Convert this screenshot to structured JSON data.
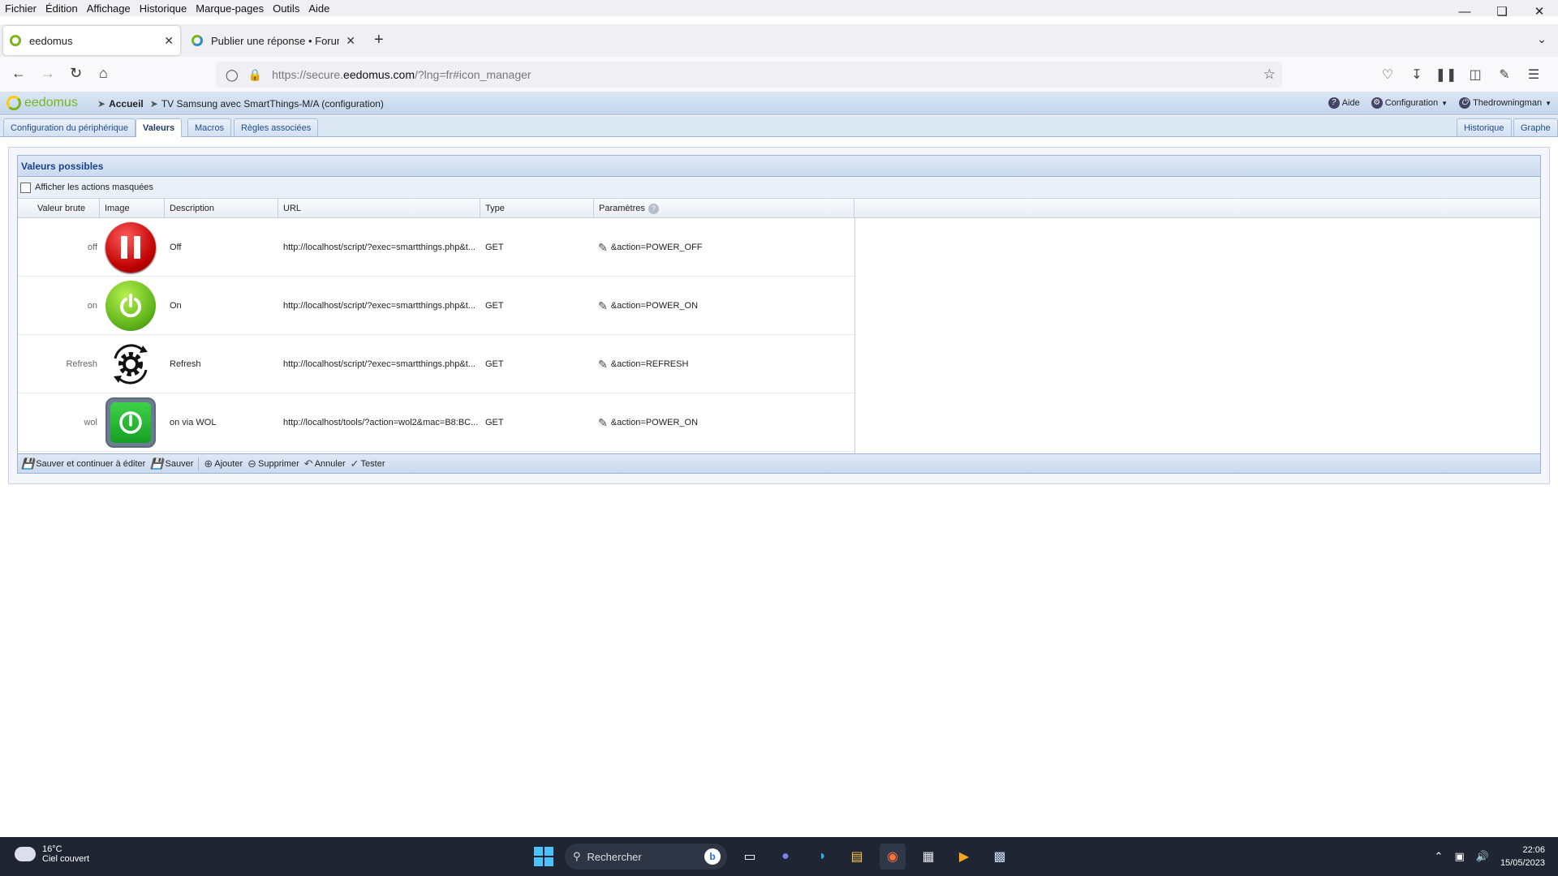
{
  "menubar": [
    "Fichier",
    "Édition",
    "Affichage",
    "Historique",
    "Marque-pages",
    "Outils",
    "Aide"
  ],
  "browser": {
    "tabs": [
      {
        "title": "eedomus",
        "active": true
      },
      {
        "title": "Publier une réponse • Forum ee",
        "active": false
      }
    ],
    "url_prefix": "https://secure.",
    "url_domain": "eedomus.com",
    "url_suffix": "/?lng=fr#icon_manager"
  },
  "app": {
    "logo": "eedomus",
    "breadcrumb_home": "Accueil",
    "breadcrumb_device": "TV Samsung avec SmartThings-M/A (configuration)",
    "help": "Aide",
    "config": "Configuration",
    "user": "Thedrowningman",
    "tabs": [
      "Configuration du périphérique",
      "Valeurs",
      "Macros",
      "Règles associées"
    ],
    "right_tabs": [
      "Historique",
      "Graphe"
    ]
  },
  "panel": {
    "title": "Valeurs possibles",
    "show_hidden": "Afficher les actions masquées",
    "columns": [
      "Valeur brute",
      "Image",
      "Description",
      "URL",
      "Type",
      "Paramètres"
    ],
    "rows": [
      {
        "raw": "off",
        "icon": "pause-red-icon",
        "desc": "Off",
        "url": "http://localhost/script/?exec=smartthings.php&t...",
        "type": "GET",
        "params": "&action=POWER_OFF"
      },
      {
        "raw": "on",
        "icon": "power-green-icon",
        "desc": "On",
        "url": "http://localhost/script/?exec=smartthings.php&t...",
        "type": "GET",
        "params": "&action=POWER_ON"
      },
      {
        "raw": "Refresh",
        "icon": "refresh-gear-icon",
        "desc": "Refresh",
        "url": "http://localhost/script/?exec=smartthings.php&t...",
        "type": "GET",
        "params": "&action=REFRESH"
      },
      {
        "raw": "wol",
        "icon": "power-square-icon",
        "desc": "on via WOL",
        "url": "http://localhost/tools/?action=wol2&mac=B8:BC...",
        "type": "GET",
        "params": "&action=POWER_ON"
      }
    ],
    "buttons": {
      "save_continue": "Sauver et continuer à éditer",
      "save": "Sauver",
      "add": "Ajouter",
      "delete": "Supprimer",
      "cancel": "Annuler",
      "test": "Tester"
    }
  },
  "taskbar": {
    "temp": "16°C",
    "weather": "Ciel couvert",
    "search": "Rechercher",
    "time": "22:06",
    "date": "15/05/2023"
  }
}
